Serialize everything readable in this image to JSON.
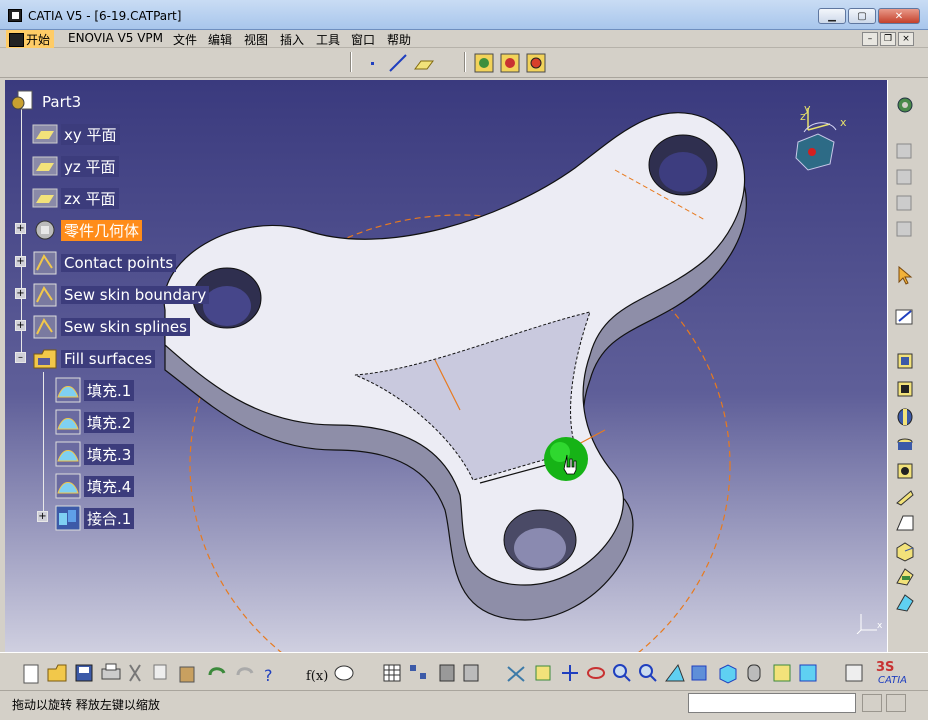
{
  "window": {
    "title": "CATIA V5 - [6-19.CATPart]",
    "buttons": {
      "minimize": "▁",
      "maximize": "▢",
      "close": "✕"
    }
  },
  "menu": {
    "items": [
      "开始",
      "ENOVIA V5 VPM",
      "文件",
      "编辑",
      "视图",
      "插入",
      "工具",
      "窗口",
      "帮助"
    ]
  },
  "mdi_buttons": {
    "minimize": "–",
    "restore": "❐",
    "close": "×"
  },
  "tree": {
    "root": "Part3",
    "nodes": [
      {
        "label": "xy 平面",
        "icon": "plane-icon"
      },
      {
        "label": "yz 平面",
        "icon": "plane-icon"
      },
      {
        "label": "zx 平面",
        "icon": "plane-icon"
      },
      {
        "label": "零件几何体",
        "icon": "part-body-icon",
        "selected": true
      },
      {
        "label": "Contact points",
        "icon": "geometrical-set-icon"
      },
      {
        "label": "Sew skin boundary",
        "icon": "geometrical-set-icon"
      },
      {
        "label": "Sew skin splines",
        "icon": "geometrical-set-icon"
      },
      {
        "label": "Fill surfaces",
        "icon": "geometrical-set-open-icon"
      },
      {
        "label": "填充.1",
        "icon": "fill-surface-icon"
      },
      {
        "label": "填充.2",
        "icon": "fill-surface-icon"
      },
      {
        "label": "填充.3",
        "icon": "fill-surface-icon"
      },
      {
        "label": "填充.4",
        "icon": "fill-surface-icon"
      },
      {
        "label": "接合.1",
        "icon": "join-icon"
      }
    ]
  },
  "compass": {
    "x_label": "x",
    "y_label": "y",
    "z_label": "z"
  },
  "status": {
    "message": "拖动以旋转  释放左键以缩放"
  },
  "colors": {
    "selection": "#ff8c1a",
    "viewport_top": "#3a3a7e",
    "viewport_bottom": "#cfcfe0",
    "tag_bg": "#3c3c7c",
    "construction_line": "#e87a1e"
  },
  "brand": {
    "logo_text": "CATIA"
  }
}
